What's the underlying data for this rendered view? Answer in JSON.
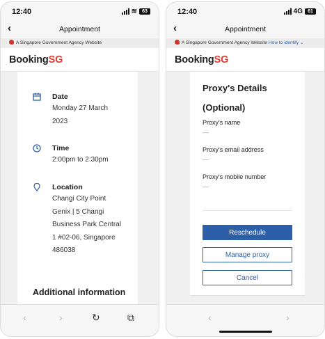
{
  "left": {
    "status": {
      "time": "12:40",
      "battery": "63"
    },
    "nav": {
      "title": "Appointment",
      "back": "‹"
    },
    "gov_banner": "A Singapore Government Agency Website",
    "brand": {
      "main": "Booking",
      "accent": "SG"
    },
    "details": [
      {
        "icon": "calendar-icon",
        "label": "Date",
        "lines": [
          "Monday 27 March",
          "2023"
        ]
      },
      {
        "icon": "clock-icon",
        "label": "Time",
        "lines": [
          "2:00pm to 2:30pm"
        ]
      },
      {
        "icon": "location-pin-icon",
        "label": "Location",
        "lines": [
          "Changi City Point",
          "Genix | 5 Changi",
          "Business Park Central",
          "1 #02-06, Singapore",
          "486038"
        ]
      }
    ],
    "additional_heading": "Additional information",
    "toolbar": {
      "back": "‹",
      "forward": "›",
      "reload": "↻",
      "share": "⧉"
    }
  },
  "right": {
    "status": {
      "time": "12:40",
      "network": "4G",
      "battery": "61"
    },
    "nav": {
      "title": "Appointment",
      "back": "‹"
    },
    "gov_banner": "A Singapore Government Agency Website",
    "gov_link": "How to identify ⌄",
    "brand": {
      "main": "Booking",
      "accent": "SG"
    },
    "proxy_title_1": "Proxy's Details",
    "proxy_title_2": "(Optional)",
    "fields": [
      {
        "label": "Proxy's name",
        "value": "—"
      },
      {
        "label": "Proxy's email address",
        "value": "—"
      },
      {
        "label": "Proxy's mobile number",
        "value": "—"
      }
    ],
    "buttons": {
      "reschedule": "Reschedule",
      "manage_proxy": "Manage proxy",
      "cancel": "Cancel"
    },
    "toolbar": {
      "back": "‹",
      "forward": "›"
    }
  },
  "colors": {
    "brand_red": "#e03c31",
    "primary_blue": "#2d5ea8"
  }
}
